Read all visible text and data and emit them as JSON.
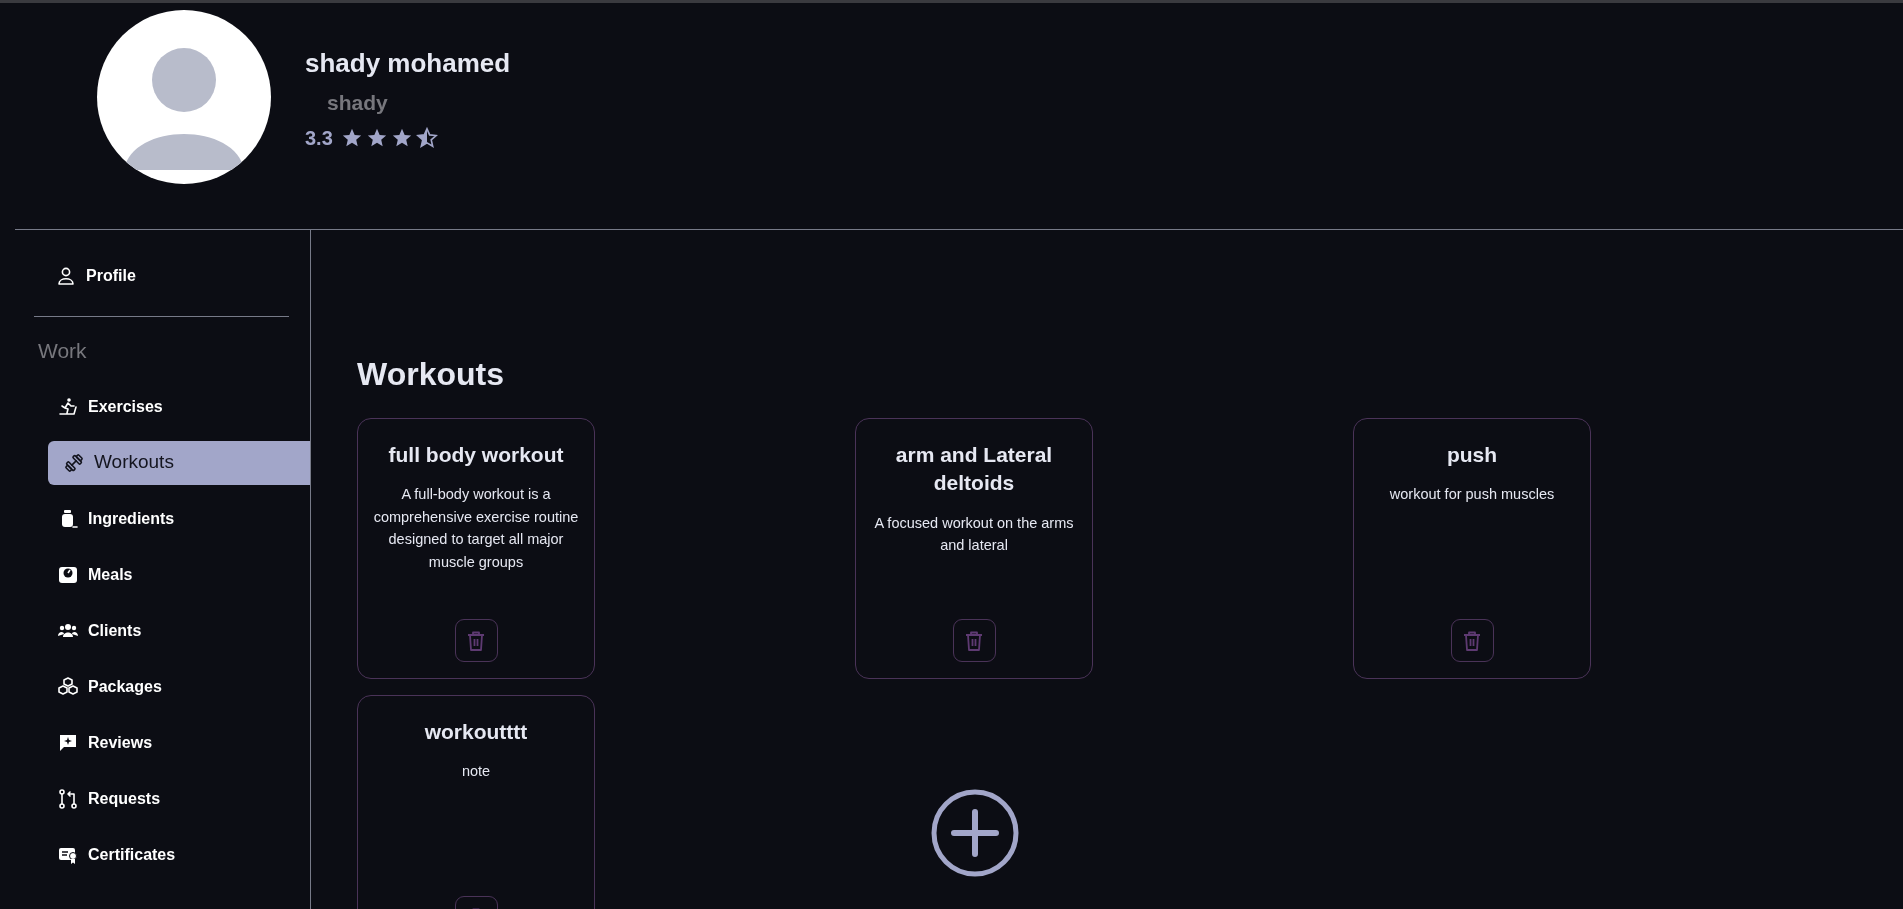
{
  "profile": {
    "name": "shady mohamed",
    "username": "shady",
    "rating": "3.3",
    "stars": 3.5
  },
  "sidebar": {
    "top_items": [
      {
        "label": "Profile",
        "kind": "person",
        "selected": false
      }
    ],
    "section_title": "Work",
    "items": [
      {
        "label": "Exercises",
        "kind": "treadmill",
        "selected": false
      },
      {
        "label": "Workouts",
        "kind": "dumbbell",
        "selected": true
      },
      {
        "label": "Ingredients",
        "kind": "jar",
        "selected": false
      },
      {
        "label": "Meals",
        "kind": "scale",
        "selected": false
      },
      {
        "label": "Clients",
        "kind": "people",
        "selected": false
      },
      {
        "label": "Packages",
        "kind": "boxes",
        "selected": false
      },
      {
        "label": "Reviews",
        "kind": "chat",
        "selected": false
      },
      {
        "label": "Requests",
        "kind": "pull",
        "selected": false
      },
      {
        "label": "Certificates",
        "kind": "certificate",
        "selected": false
      }
    ]
  },
  "main": {
    "title": "Workouts",
    "workouts": [
      {
        "title": "full body workout",
        "description": "A full-body workout is a comprehensive exercise routine designed to target all major muscle groups"
      },
      {
        "title": "arm and Lateral deltoids",
        "description": "A focused workout on the arms and lateral"
      },
      {
        "title": "push",
        "description": "workout for push muscles"
      },
      {
        "title": "workoutttt",
        "description": "note"
      }
    ]
  }
}
